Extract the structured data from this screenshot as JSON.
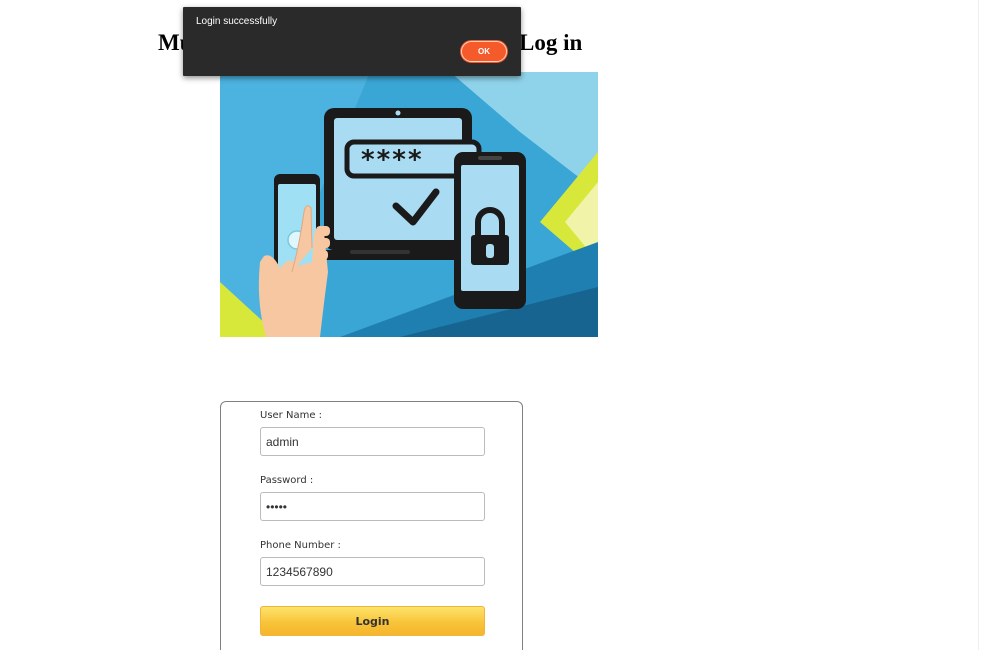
{
  "heading": {
    "left_visible": "Mu",
    "right_visible": "Log in"
  },
  "hero_image": {
    "icon": "multi-factor-login-illustration",
    "password_mask": "****"
  },
  "dialog": {
    "message": "Login successfully",
    "ok_label": "OK",
    "colors": {
      "background": "#2a2a2a",
      "ok_button": "#f45a2a"
    }
  },
  "form": {
    "username": {
      "label": "User Name :",
      "value": "admin"
    },
    "password": {
      "label": "Password :",
      "value": "admin"
    },
    "phone": {
      "label": "Phone Number :",
      "value": "1234567890"
    },
    "login_label": "Login",
    "colors": {
      "login_button": "#f8c43a"
    }
  }
}
